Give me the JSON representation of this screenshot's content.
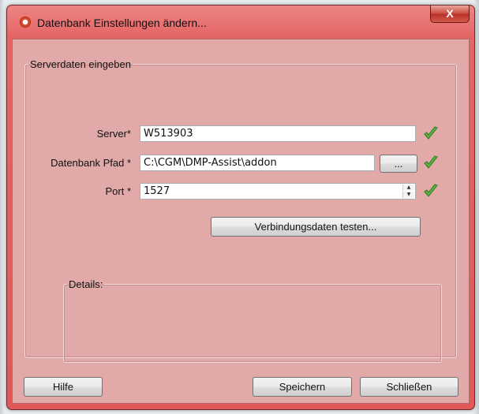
{
  "window": {
    "title": "Datenbank Einstellungen ändern...",
    "close_label": "X"
  },
  "group": {
    "label": "Serverdaten eingeben"
  },
  "server": {
    "label": "Server*",
    "value": "W513903"
  },
  "db_path": {
    "label": "Datenbank Pfad *",
    "value": "C:\\CGM\\DMP-Assist\\addon",
    "browse_label": "..."
  },
  "port": {
    "label": "Port *",
    "value": "1527"
  },
  "test_button": "Verbindungsdaten testen...",
  "details": {
    "label": "Details:"
  },
  "buttons": {
    "help": "Hilfe",
    "save": "Speichern",
    "close": "Schließen"
  },
  "colors": {
    "window_frame": "#e05858",
    "client_bg": "#e2a9a9",
    "check": "#3f9b2f"
  },
  "icons": [
    "app-icon",
    "check-icon",
    "spin-up-icon",
    "spin-down-icon"
  ]
}
